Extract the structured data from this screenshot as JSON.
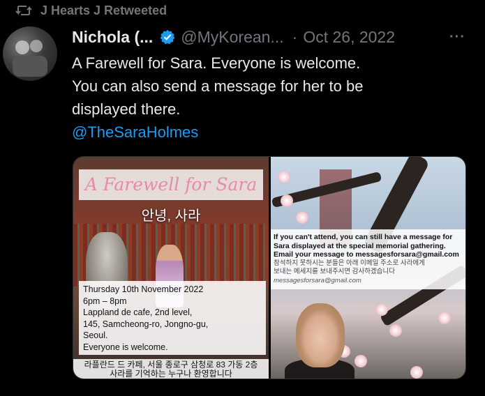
{
  "retweet": {
    "label": "J Hearts J Retweeted",
    "icon": "retweet-icon"
  },
  "tweet": {
    "author_name": "Nichola (...",
    "handle": "@MyKorean...",
    "separator": "·",
    "date": "Oct 26, 2022",
    "more_label": "···",
    "text_lines": [
      "A Farewell for Sara. Everyone is welcome.",
      "You can also send a message for her to be",
      "displayed there."
    ],
    "mention": "@TheSaraHolmes"
  },
  "media": {
    "left": {
      "title": "A Farewell for Sara",
      "korean_title": "안녕, 사라",
      "details": [
        "Thursday 10th November 2022",
        "6pm – 8pm",
        "Lappland de cafe, 2nd level,",
        "145, Samcheong-ro, Jongno-gu,",
        "Seoul.",
        "Everyone is welcome."
      ],
      "korean_footer": [
        "라플란드 드 카페, 서울 종로구 삼청로 83 가동 2층",
        "사라를 기억하는 누구나 환영합니다"
      ]
    },
    "right": {
      "lines": [
        "If you can't attend, you can still have a message for",
        "Sara displayed at the special memorial gathering.",
        "Email your message to messagesforsara@gmail.com"
      ],
      "korean_lines": [
        "참석하지 못하시는 분들은 아래 이메일 주소로 사라에게",
        "보내는 메세지를 보내주시면 감사하겠습니다"
      ],
      "email": "messagesforsara@gmail.com"
    }
  },
  "colors": {
    "background": "#000000",
    "primary_text": "#e7e9ea",
    "secondary_text": "#71767b",
    "link": "#1d9bf0",
    "verified": "#1d9bf0"
  }
}
